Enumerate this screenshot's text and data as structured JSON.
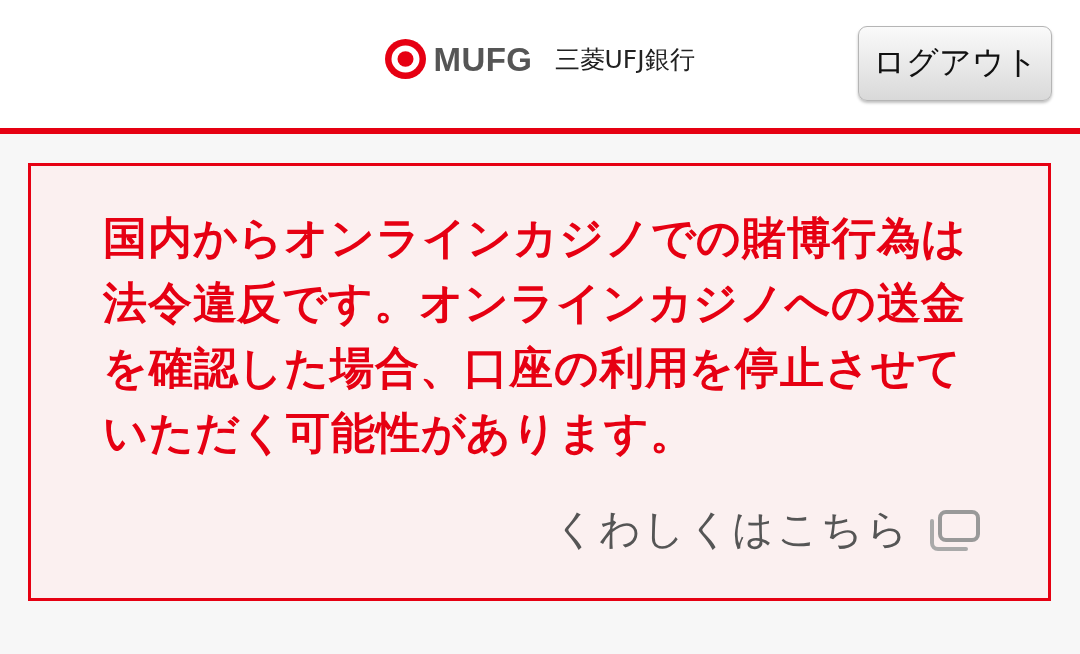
{
  "header": {
    "logo": {
      "mark": "MUFG",
      "bank_name": "三菱UFJ銀行"
    },
    "logout_button": "ログアウト"
  },
  "notice": {
    "message": "国内からオンラインカジノでの賭博行為は法令違反です。オンラインカジノへの送金を確認した場合、口座の利用を停止させていただく可能性があります。",
    "link": "くわしくはこちら"
  }
}
